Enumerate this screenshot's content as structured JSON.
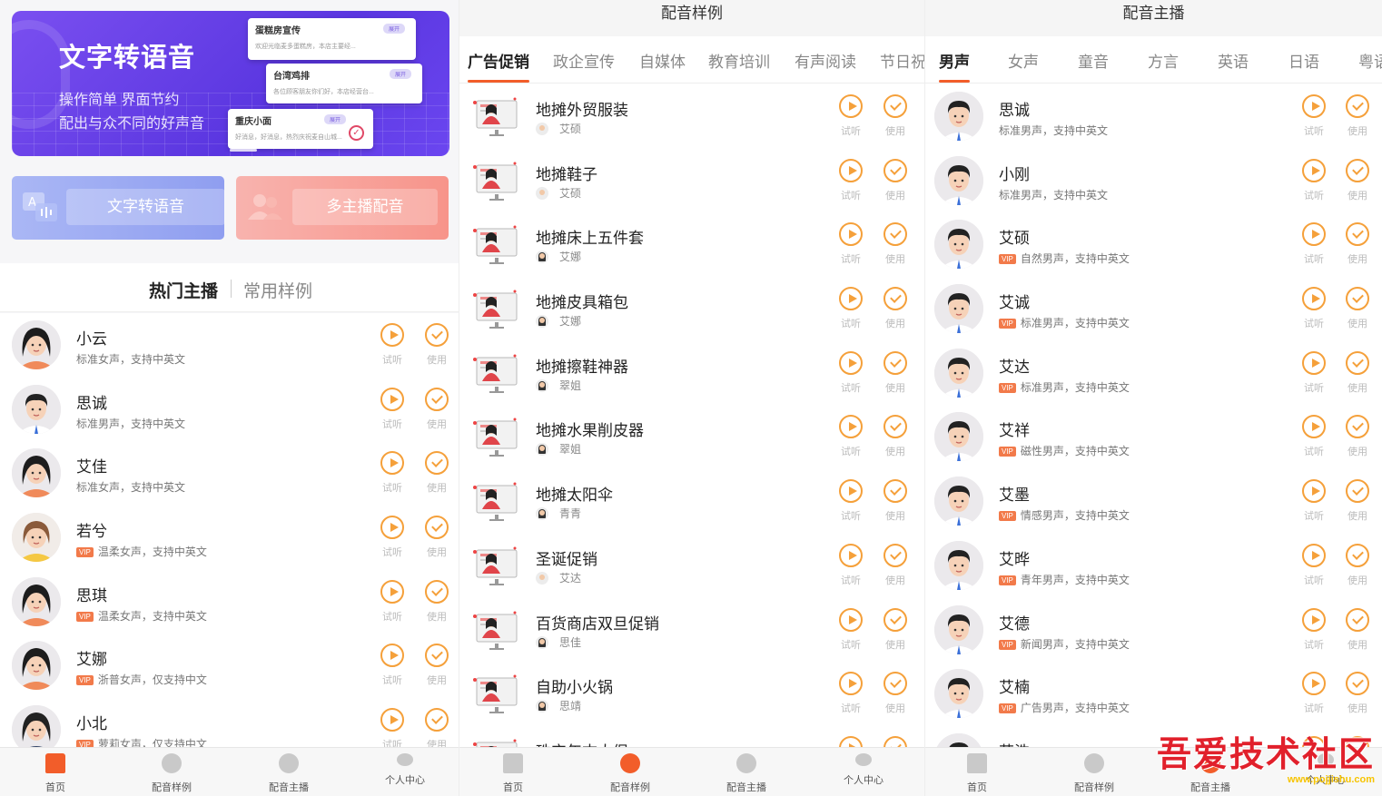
{
  "home": {
    "banner": {
      "title": "文字转语音",
      "line1": "操作简单 界面节约",
      "line2": "配出与众不同的好声音",
      "cards": [
        {
          "title": "蛋糕房宣传",
          "badge": "展开",
          "text": "欢迎光临麦多蛋糕房，本店主要经..."
        },
        {
          "title": "台湾鸡排",
          "badge": "展开",
          "text": "各位顾客朋友你们好，本店经营台..."
        },
        {
          "title": "重庆小面",
          "badge": "展开",
          "text": "好消息，好消息，热烈庆祝麦自山城..."
        }
      ],
      "card_check_label": "完成"
    },
    "btn_tts": "文字转语音",
    "btn_multi": "多主播配音",
    "seg_active": "热门主播",
    "seg_other": "常用样例",
    "list": [
      {
        "name": "小云",
        "vip": false,
        "desc": "标准女声，支持中英文",
        "g": "f"
      },
      {
        "name": "思诚",
        "vip": false,
        "desc": "标准男声，支持中英文",
        "g": "m"
      },
      {
        "name": "艾佳",
        "vip": false,
        "desc": "标准女声，支持中英文",
        "g": "f"
      },
      {
        "name": "若兮",
        "vip": true,
        "desc": "温柔女声，支持中英文",
        "g": "y"
      },
      {
        "name": "思琪",
        "vip": true,
        "desc": "温柔女声，支持中英文",
        "g": "f"
      },
      {
        "name": "艾娜",
        "vip": true,
        "desc": "浙普女声，仅支持中文",
        "g": "f"
      },
      {
        "name": "小北",
        "vip": true,
        "desc": "萝莉女声，仅支持中文",
        "g": "s"
      }
    ]
  },
  "samples": {
    "title": "配音样例",
    "tabs": [
      "广告促销",
      "政企宣传",
      "自媒体",
      "教育培训",
      "有声阅读",
      "节日祝"
    ],
    "list": [
      {
        "name": "地摊外贸服装",
        "voice": "艾硕",
        "g": "m"
      },
      {
        "name": "地摊鞋子",
        "voice": "艾硕",
        "g": "m"
      },
      {
        "name": "地摊床上五件套",
        "voice": "艾娜",
        "g": "f"
      },
      {
        "name": "地摊皮具箱包",
        "voice": "艾娜",
        "g": "f"
      },
      {
        "name": "地摊擦鞋神器",
        "voice": "翠姐",
        "g": "f"
      },
      {
        "name": "地摊水果削皮器",
        "voice": "翠姐",
        "g": "f"
      },
      {
        "name": "地摊太阳伞",
        "voice": "青青",
        "g": "f"
      },
      {
        "name": "圣诞促销",
        "voice": "艾达",
        "g": "m"
      },
      {
        "name": "百货商店双旦促销",
        "voice": "思佳",
        "g": "f"
      },
      {
        "name": "自助小火锅",
        "voice": "思靖",
        "g": "f"
      },
      {
        "name": "珠宝年末大促",
        "voice": "",
        "g": "f"
      }
    ]
  },
  "anchors": {
    "title": "配音主播",
    "tabs": [
      "男声",
      "女声",
      "童音",
      "方言",
      "英语",
      "日语",
      "粤语"
    ],
    "list": [
      {
        "name": "思诚",
        "vip": false,
        "desc": "标准男声，支持中英文"
      },
      {
        "name": "小刚",
        "vip": false,
        "desc": "标准男声，支持中英文"
      },
      {
        "name": "艾硕",
        "vip": true,
        "desc": "自然男声，支持中英文"
      },
      {
        "name": "艾诚",
        "vip": true,
        "desc": "标准男声，支持中英文"
      },
      {
        "name": "艾达",
        "vip": true,
        "desc": "标准男声，支持中英文"
      },
      {
        "name": "艾祥",
        "vip": true,
        "desc": "磁性男声，支持中英文"
      },
      {
        "name": "艾墨",
        "vip": true,
        "desc": "情感男声，支持中英文"
      },
      {
        "name": "艾晔",
        "vip": true,
        "desc": "青年男声，支持中英文"
      },
      {
        "name": "艾德",
        "vip": true,
        "desc": "新闻男声，支持中英文"
      },
      {
        "name": "艾楠",
        "vip": true,
        "desc": "广告男声，支持中英文"
      },
      {
        "name": "艾浩",
        "vip": false,
        "desc": ""
      }
    ]
  },
  "common": {
    "listen": "试听",
    "use": "使用",
    "vip": "VIP",
    "tabbar": [
      "首页",
      "配音样例",
      "配音主播",
      "个人中心"
    ]
  },
  "watermark": {
    "text": "吾爱技术社区",
    "url": "www.pojjishu.com"
  },
  "colors": {
    "accent": "#f25d2a",
    "action": "#f5a03a",
    "banner": "#6b46f0"
  }
}
